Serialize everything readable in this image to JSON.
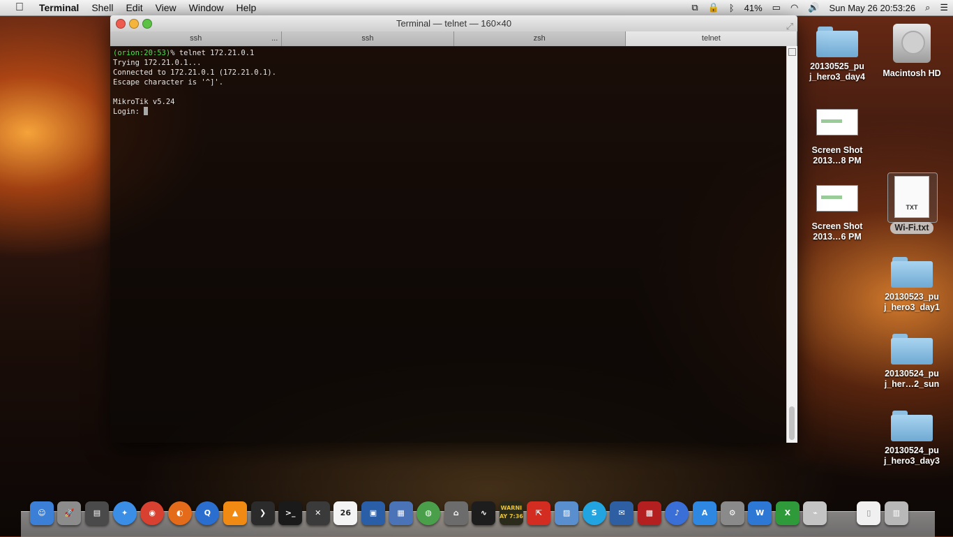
{
  "menubar": {
    "apple": "",
    "app_name": "Terminal",
    "items": [
      "Shell",
      "Edit",
      "View",
      "Window",
      "Help"
    ],
    "battery": "41%",
    "clock": "Sun May 26  20:53:26"
  },
  "window": {
    "title": "Terminal — telnet — 160×40",
    "tabs": [
      {
        "label": "ssh",
        "extra": "..."
      },
      {
        "label": "ssh",
        "extra": ""
      },
      {
        "label": "zsh",
        "extra": ""
      },
      {
        "label": "telnet",
        "extra": ""
      }
    ],
    "terminal": {
      "prompt_user": "(orion:20:53)",
      "prompt_cmd": "% telnet 172.21.0.1",
      "lines": [
        "Trying 172.21.0.1...",
        "Connected to 172.21.0.1 (172.21.0.1).",
        "Escape character is '^]'.",
        "",
        "MikroTik v5.24"
      ],
      "login_prompt": "Login: "
    }
  },
  "desktop": {
    "items": [
      {
        "label1": "20130525_pu",
        "label2": "j_hero3_day4",
        "kind": "folder"
      },
      {
        "label1": "Macintosh HD",
        "label2": "",
        "kind": "hard-drive"
      },
      {
        "label1": "Screen Shot",
        "label2": "2013…8 PM",
        "kind": "screenshot"
      },
      {
        "label1": "Screen Shot",
        "label2": "2013…6 PM",
        "kind": "screenshot"
      },
      {
        "label1": "Wi-Fi.txt",
        "label2": "",
        "kind": "text-file",
        "badge": "TXT"
      },
      {
        "label1": "20130523_pu",
        "label2": "j_hero3_day1",
        "kind": "folder"
      },
      {
        "label1": "20130524_pu",
        "label2": "j_her…2_sun",
        "kind": "folder"
      },
      {
        "label1": "20130524_pu",
        "label2": "j_hero3_day3",
        "kind": "folder"
      }
    ]
  },
  "dock": {
    "calendar_day": "26",
    "console_text": "WARNI",
    "console_time": "AY 7:36",
    "apps": [
      {
        "name": "finder-icon",
        "color": "#3b7fd6"
      },
      {
        "name": "launchpad-icon",
        "color": "#8c8c8c"
      },
      {
        "name": "network-utility-icon",
        "color": "#4a4a4a"
      },
      {
        "name": "safari-icon",
        "color": "#3a8ee6"
      },
      {
        "name": "chrome-icon",
        "color": "#d8402f"
      },
      {
        "name": "firefox-icon",
        "color": "#e46b1a"
      },
      {
        "name": "quicktime-icon",
        "color": "#2a6fd0"
      },
      {
        "name": "vlc-icon",
        "color": "#f08a12"
      },
      {
        "name": "plex-icon",
        "color": "#2b2b2b"
      },
      {
        "name": "terminal-icon",
        "color": "#1a1a1a"
      },
      {
        "name": "x11-icon",
        "color": "#3a3a3a"
      },
      {
        "name": "calendar-icon",
        "color": "#f4f4f4"
      },
      {
        "name": "virtualbox-icon",
        "color": "#2a5fa8"
      },
      {
        "name": "vmware-icon",
        "color": "#4b74b8"
      },
      {
        "name": "network-icon",
        "color": "#4aa04a"
      },
      {
        "name": "lock-icon",
        "color": "#6c6c6c"
      },
      {
        "name": "activity-monitor-icon",
        "color": "#1d1d1d"
      },
      {
        "name": "console-icon",
        "color": "#2b2b1b"
      },
      {
        "name": "remote-desktop-icon",
        "color": "#d32d22"
      },
      {
        "name": "preview-icon",
        "color": "#5a8fcf"
      },
      {
        "name": "skype-icon",
        "color": "#22a4e0"
      },
      {
        "name": "thunderbird-icon",
        "color": "#2d5fa2"
      },
      {
        "name": "photo-booth-icon",
        "color": "#b42020"
      },
      {
        "name": "itunes-icon",
        "color": "#3a6fd8"
      },
      {
        "name": "app-store-icon",
        "color": "#2e87e0"
      },
      {
        "name": "system-preferences-icon",
        "color": "#8a8a8a"
      },
      {
        "name": "word-icon",
        "color": "#2d78d4"
      },
      {
        "name": "excel-icon",
        "color": "#2f9a3a"
      },
      {
        "name": "wifi-diagnostics-icon",
        "color": "#c4c4c4"
      },
      {
        "name": "document-icon",
        "color": "#f0f0f0"
      },
      {
        "name": "trash-icon",
        "color": "#b8b8b8"
      }
    ]
  }
}
